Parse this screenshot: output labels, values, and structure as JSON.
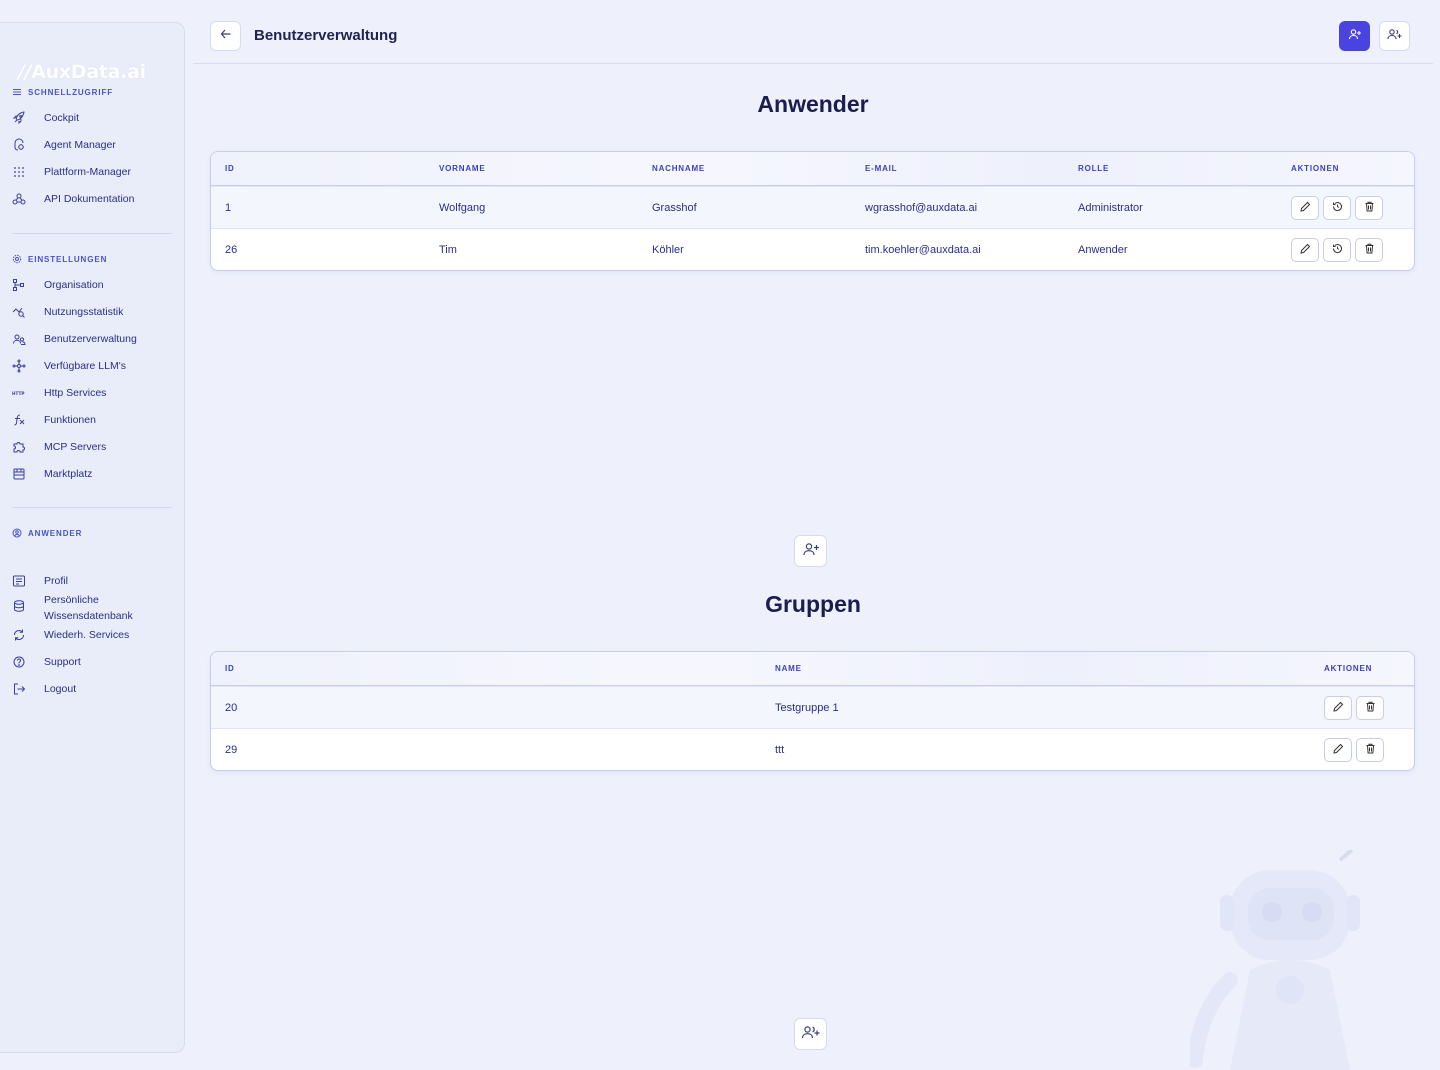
{
  "brand": {
    "logo_text": "AuxData.ai"
  },
  "sidebar": {
    "sections": [
      {
        "title": "SCHNELLZUGRIFF",
        "items": [
          {
            "label": "Cockpit",
            "icon": "rocket-icon"
          },
          {
            "label": "Agent Manager",
            "icon": "agent-icon"
          },
          {
            "label": "Plattform-Manager",
            "icon": "grid-icon"
          },
          {
            "label": "API Dokumentation",
            "icon": "webhook-icon"
          }
        ]
      },
      {
        "title": "EINSTELLUNGEN",
        "items": [
          {
            "label": "Organisation",
            "icon": "org-icon"
          },
          {
            "label": "Nutzungsstatistik",
            "icon": "stats-icon"
          },
          {
            "label": "Benutzerverwaltung",
            "icon": "users-icon"
          },
          {
            "label": "Verfügbare LLM's",
            "icon": "llm-icon"
          },
          {
            "label": "Http Services",
            "icon": "http-icon"
          },
          {
            "label": "Funktionen",
            "icon": "function-icon"
          },
          {
            "label": "MCP Servers",
            "icon": "puzzle-icon"
          },
          {
            "label": "Marktplatz",
            "icon": "store-icon"
          }
        ]
      },
      {
        "title": "ANWENDER",
        "items": [
          {
            "label": "Profil",
            "icon": "profile-icon"
          },
          {
            "label": "Persönliche\nWissensdatenbank",
            "icon": "database-icon"
          },
          {
            "label": "Wiederh. Services",
            "icon": "recurring-icon"
          },
          {
            "label": "Support",
            "icon": "help-icon"
          },
          {
            "label": "Logout",
            "icon": "logout-icon"
          }
        ]
      }
    ]
  },
  "header": {
    "title": "Benutzerverwaltung"
  },
  "users": {
    "heading": "Anwender",
    "columns": [
      "ID",
      "VORNAME",
      "NACHNAME",
      "E-MAIL",
      "ROLLE",
      "AKTIONEN"
    ],
    "rows": [
      {
        "id": "1",
        "vorname": "Wolfgang",
        "nachname": "Grasshof",
        "email": "wgrasshof@auxdata.ai",
        "rolle": "Administrator"
      },
      {
        "id": "26",
        "vorname": "Tim",
        "nachname": "Köhler",
        "email": "tim.koehler@auxdata.ai",
        "rolle": "Anwender"
      }
    ]
  },
  "groups": {
    "heading": "Gruppen",
    "columns": [
      "ID",
      "NAME",
      "AKTIONEN"
    ],
    "rows": [
      {
        "id": "20",
        "name": "Testgruppe 1"
      },
      {
        "id": "29",
        "name": "ttt"
      }
    ]
  },
  "colors": {
    "accent": "#4b43e0",
    "text": "#2a2f86",
    "background": "#eef1fb"
  }
}
